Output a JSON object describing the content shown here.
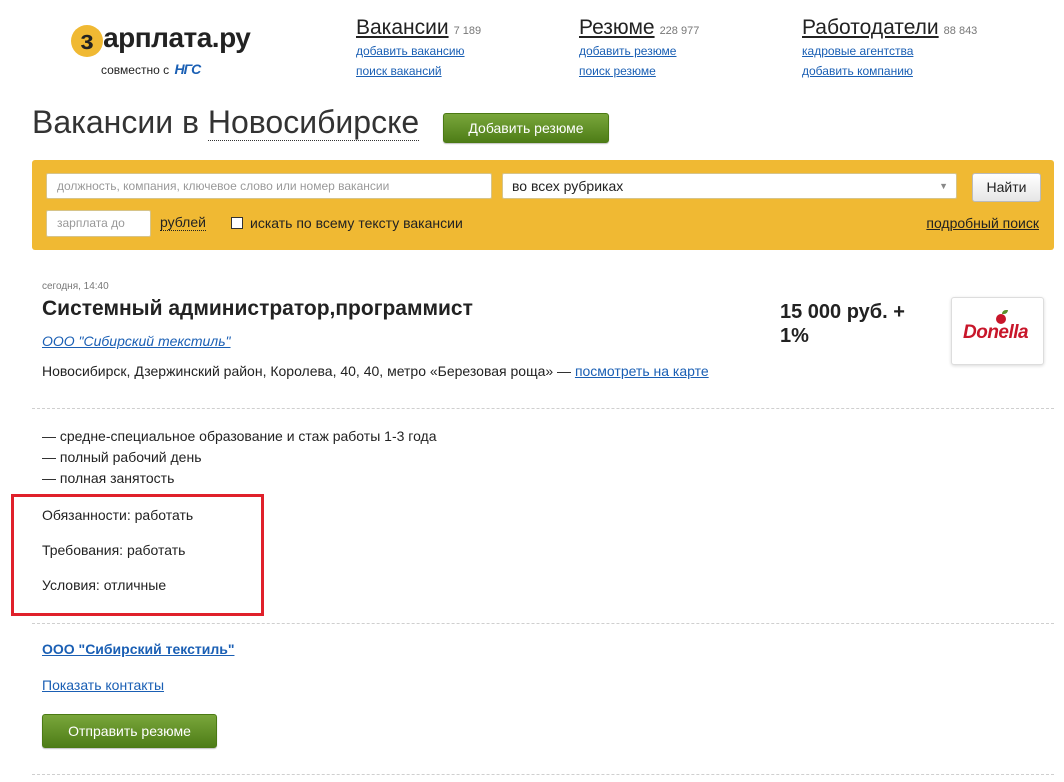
{
  "header": {
    "logo_text": "зарплата.ру",
    "logo_mark": "з",
    "partner_text": "совместно с",
    "partner_name": "НГС",
    "nav": [
      {
        "title": "Вакансии",
        "count": "7 189",
        "links": [
          "добавить вакансию",
          "поиск вакансий"
        ]
      },
      {
        "title": "Резюме",
        "count": "228 977",
        "links": [
          "добавить резюме",
          "поиск резюме"
        ]
      },
      {
        "title": "Работодатели",
        "count": "88 843",
        "links": [
          "кадровые агентства",
          "добавить компанию"
        ]
      }
    ]
  },
  "page": {
    "title_prefix": "Вакансии в",
    "city": "Новосибирске",
    "add_resume_button": "Добавить резюме"
  },
  "search": {
    "query_placeholder": "должность, компания, ключевое слово или номер вакансии",
    "rubric_value": "во всех рубриках",
    "find_button": "Найти",
    "salary_placeholder": "зарплата до",
    "currency": "рублей",
    "fulltext_label": "искать по всему тексту вакансии",
    "fulltext_checked": false,
    "advanced_link": "подробный поиск"
  },
  "vacancy": {
    "date": "сегодня, 14:40",
    "title": "Системный администратор,программист",
    "company": "ООО \"Сибирский текстиль\"",
    "address": "Новосибирск, Дзержинский район, Королева, 40, 40, метро «Березовая роща» —",
    "map_link": "посмотреть на карте",
    "salary": "15 000 руб. + 1%",
    "employer_logo_text": "Donella",
    "requirements": [
      "— средне-специальное образование и стаж работы 1-3 года",
      "— полный рабочий день",
      "— полная занятость"
    ],
    "duties": "Обязанности: работать",
    "demands": "Требования: работать",
    "conditions": "Условия: отличные",
    "company_bottom": "ООО \"Сибирский текстиль\"",
    "show_contacts": "Показать контакты",
    "send_resume_button": "Отправить резюме"
  },
  "colors": {
    "accent_yellow": "#f0b933",
    "button_green": "#5a8a1f",
    "link_blue": "#1a5fb4",
    "highlight_red": "#e0202a"
  }
}
